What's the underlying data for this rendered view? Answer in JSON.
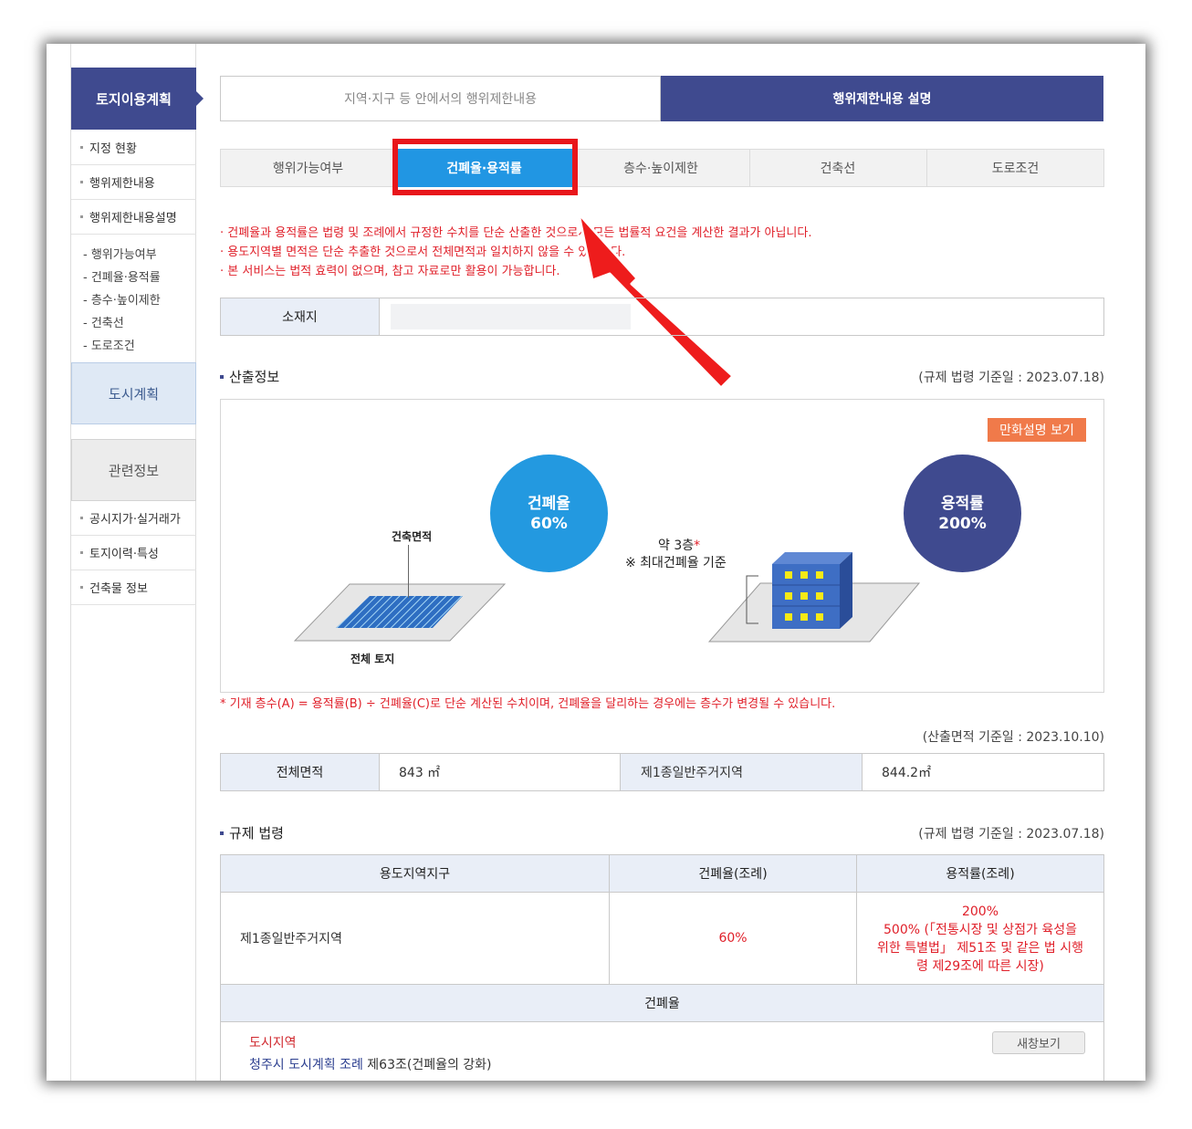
{
  "sidebar": {
    "head": "토지이용계획",
    "items": [
      "지정 현황",
      "행위제한내용",
      "행위제한내용설명"
    ],
    "sub_items": [
      "- 행위가능여부",
      "- 건폐율·용적률",
      "- 층수·높이제한",
      "- 건축선",
      "- 도로조건"
    ],
    "city_plan": "도시계획",
    "related": "관련정보",
    "related_items": [
      "공시지가·실거래가",
      "토지이력·특성",
      "건축물 정보"
    ]
  },
  "top_tabs": [
    "지역·지구 등 안에서의 행위제한내용",
    "행위제한내용 설명"
  ],
  "sub_tabs": [
    "행위가능여부",
    "건폐율·용적률",
    "층수·높이제한",
    "건축선",
    "도로조건"
  ],
  "notes": [
    "· 건폐율과 용적률은 법령 및 조례에서 규정한 수치를 단순 산출한 것으로서 모든 법률적 요건을 계산한 결과가 아닙니다.",
    "· 용도지역별 면적은 단순 추출한 것으로서 전체면적과 일치하지 않을 수 있습니다.",
    "· 본 서비스는 법적 효력이 없으며, 참고 자료로만 활용이 가능합니다."
  ],
  "location": {
    "label": "소재지",
    "value": ""
  },
  "calc": {
    "title": "산출정보",
    "date": "(규제 법령 기준일 : 2023.07.18)",
    "cartoon_button": "만화설명 보기",
    "bcr_label": "건폐율",
    "bcr_value": "60%",
    "far_label": "용적률",
    "far_value": "200%",
    "building_area": "건축면적",
    "total_land": "전체 토지",
    "floors": "약 3층",
    "floors_star": "*",
    "floors_note": "※ 최대건폐율 기준",
    "footnote": "* 기재 층수(A) = 용적률(B) ÷ 건폐율(C)로 단순 계산된 수치이며, 건폐율을 달리하는 경우에는 층수가 변경될 수 있습니다."
  },
  "area": {
    "date": "(산출면적 기준일 : 2023.10.10)",
    "total_label": "전체면적",
    "total_value": "843 ㎡",
    "zone_label": "제1종일반주거지역",
    "zone_value": "844.2㎡"
  },
  "law": {
    "title": "규제 법령",
    "date": "(규제 법령 기준일 : 2023.07.18)",
    "headers": [
      "용도지역지구",
      "건폐율(조례)",
      "용적률(조례)"
    ],
    "row_zone": "제1종일반주거지역",
    "row_bcr": "60%",
    "row_far_lines": [
      "200%",
      "500% (「전통시장 및 상점가 육성을",
      "위한 특별법」 제51조 및 같은 법 시행",
      "령 제29조에 따른 시장)"
    ],
    "bcr_section": "건폐율",
    "city_area": "도시지역",
    "ordinance_link": "청주시 도시계획 조례",
    "ordinance_rest": " 제63조(건폐율의 강화)",
    "new_window": "새창보기"
  },
  "colors": {
    "navy": "#3f4a8f",
    "active_tab": "#2196e3",
    "highlight": "#e8161b",
    "note_red": "#e0202a",
    "orange_button": "#f07a4a"
  }
}
